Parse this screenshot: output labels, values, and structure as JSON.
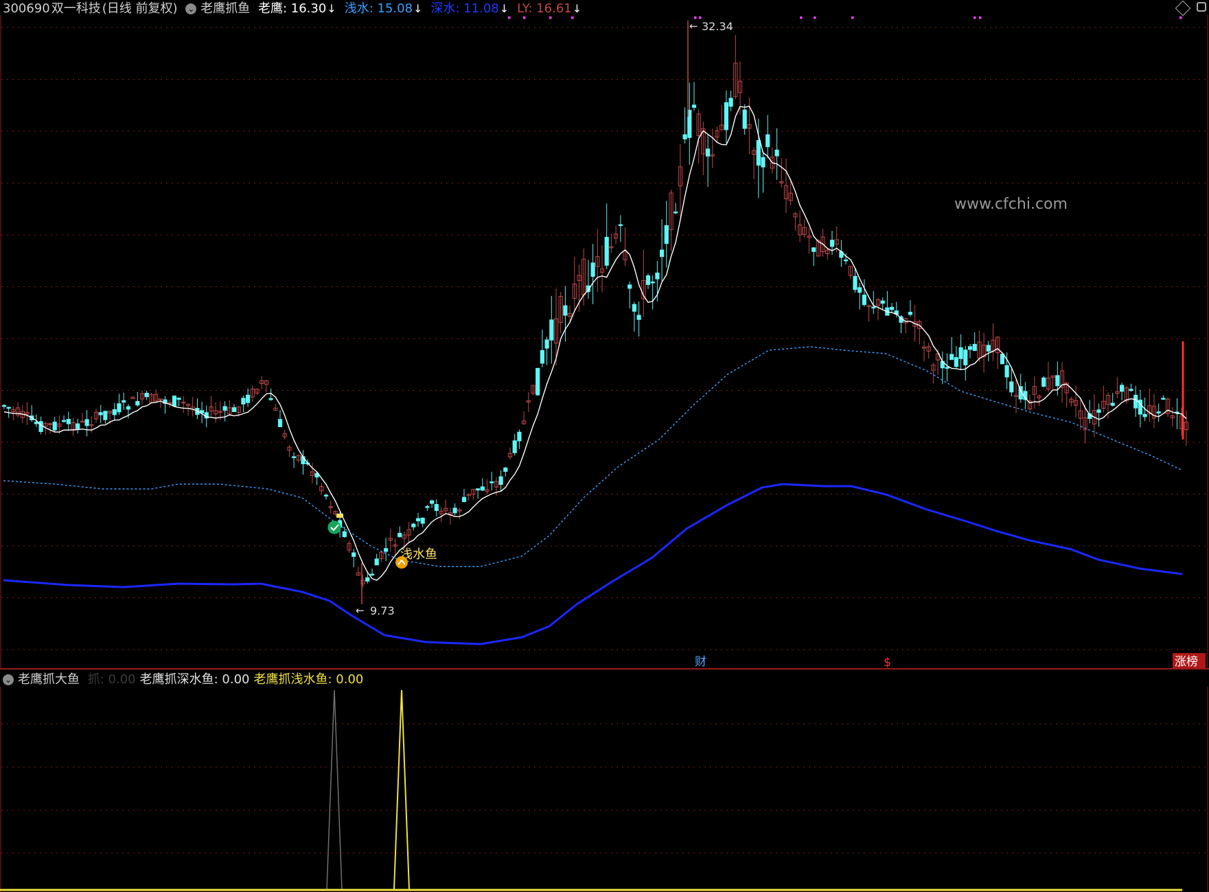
{
  "header": {
    "stock_code": "300690",
    "stock_name": "双一科技",
    "chart_mode": "(日线 前复权)",
    "indicator": "老鹰抓鱼",
    "series": [
      {
        "label": "老鹰: 16.30",
        "color": "#ffffff"
      },
      {
        "label": "浅水: 15.08",
        "color": "#3aa0ff"
      },
      {
        "label": "深水: 11.08",
        "color": "#1c3cff"
      },
      {
        "label": "LY: 16.61",
        "color": "#c04848"
      }
    ],
    "arrow_glyph": "↓"
  },
  "sub_header": {
    "indicator": "老鹰抓大鱼",
    "items": [
      {
        "label": "抓: 0.00",
        "color": "#3a3a3a"
      },
      {
        "label": "老鹰抓深水鱼: 0.00",
        "color": "#e0e0e0"
      },
      {
        "label": "老鹰抓浅水鱼: 0.00",
        "color": "#f0e040"
      }
    ]
  },
  "annotations": {
    "high_label": "32.34",
    "low_label": "9.73",
    "signal_label": "浅水鱼",
    "watermark": "www.cfchi.com",
    "bottom_markers": [
      {
        "label": "财",
        "color": "#4fa3ff"
      },
      {
        "label": "$",
        "color": "#ff3030"
      },
      {
        "label": "涨榜",
        "color": "#ffffff"
      }
    ]
  },
  "colors": {
    "up": "#c04848",
    "down": "#5ff5f5",
    "ma_fast": "#ffffff",
    "ma_mid": "#3aa0ff",
    "ma_slow": "#1a28ff",
    "grid": "#8a1a1a"
  },
  "chart_data": {
    "type": "candlestick",
    "high": 32.34,
    "low": 9.73,
    "signal_peaks": [
      {
        "name": "老鹰抓深水鱼",
        "color": "#707070"
      },
      {
        "name": "老鹰抓浅水鱼",
        "color": "#f0e040"
      }
    ]
  }
}
